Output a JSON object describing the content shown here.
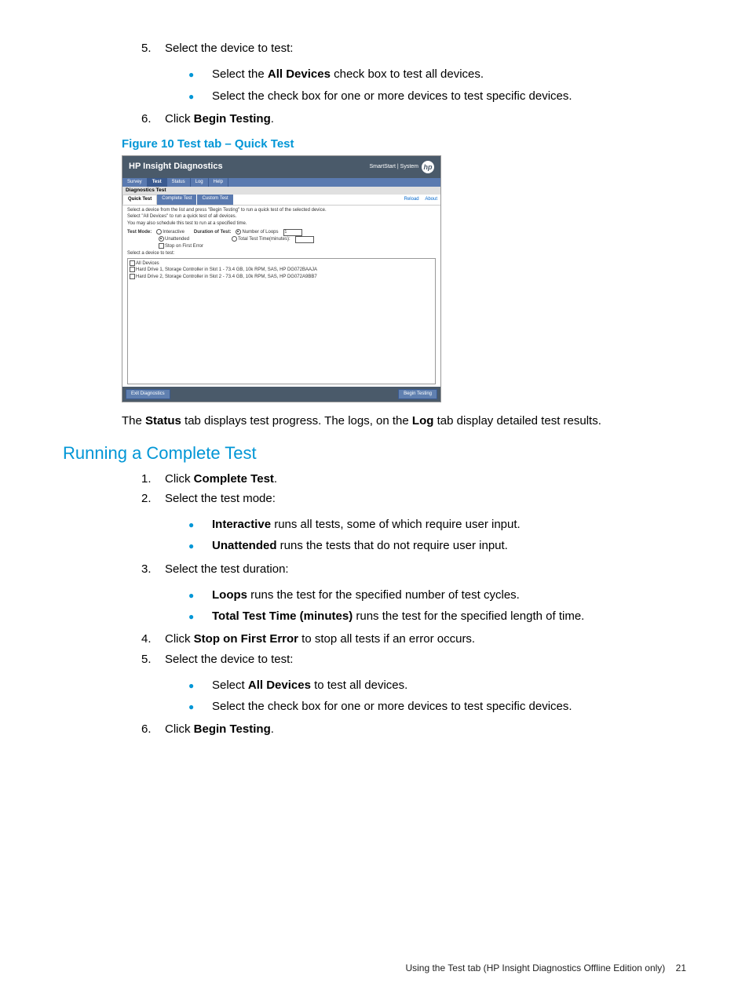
{
  "steps_top": {
    "s5": {
      "num": "5.",
      "text": "Select the device to test:",
      "bullets": [
        {
          "pre": "Select the ",
          "bold": "All Devices",
          "post": " check box to test all devices."
        },
        {
          "pre": "Select the check box for one or more devices to test specific devices.",
          "bold": "",
          "post": ""
        }
      ]
    },
    "s6": {
      "num": "6.",
      "pre": "Click ",
      "bold": "Begin Testing",
      "post": "."
    }
  },
  "figure_caption": "Figure 10 Test tab – Quick Test",
  "screenshot": {
    "title": "HP Insight Diagnostics",
    "header_right": "SmartStart | System",
    "logo": "hp",
    "tabs": [
      "Survey",
      "Test",
      "Status",
      "Log",
      "Help"
    ],
    "active_tab": "Test",
    "section_label": "Diagnostics Test",
    "subtabs": [
      "Quick Test",
      "Complete Test",
      "Custom Test"
    ],
    "active_subtab": "Quick Test",
    "links": [
      "Reload",
      "About"
    ],
    "instr1": "Select a device from the list and press \"Begin Testing\" to run a quick test of the selected device.",
    "instr2": "Select \"All Devices\" to run a quick test of all devices.",
    "instr3": "You may also schedule this test to run at a specified time.",
    "test_mode_label": "Test Mode:",
    "interactive": "Interactive",
    "unattended": "Unattended",
    "duration_label": "Duration of Test:",
    "loops_label": "Number of Loops",
    "loops_value": "1",
    "time_label": "Total Test Time(minutes):",
    "time_value": "",
    "stop_label": "Stop on First Error",
    "select_device": "Select a device to test:",
    "devices": [
      "All Devices",
      "Hard Drive 1, Storage Controller in Slot 1 - 73.4 GB, 10k RPM, SAS, HP DG072BAAJA",
      "Hard Drive 2, Storage Controller in Slot 2 - 73.4 GB, 10k RPM, SAS, HP DG072A9BB7"
    ],
    "btn_exit": "Exit Diagnostics",
    "btn_begin": "Begin Testing"
  },
  "paragraph": {
    "p1": "The ",
    "b1": "Status",
    "p2": " tab displays test progress. The logs, on the ",
    "b2": "Log",
    "p3": " tab display detailed test results."
  },
  "section_heading": "Running a Complete Test",
  "steps_bottom": {
    "s1": {
      "num": "1.",
      "pre": "Click ",
      "bold": "Complete Test",
      "post": "."
    },
    "s2": {
      "num": "2.",
      "text": "Select the test mode:",
      "bullets": [
        {
          "bold": "Interactive",
          "post": " runs all tests, some of which require user input."
        },
        {
          "bold": "Unattended",
          "post": " runs the tests that do not require user input."
        }
      ]
    },
    "s3": {
      "num": "3.",
      "text": "Select the test duration:",
      "bullets": [
        {
          "bold": "Loops",
          "post": " runs the test for the specified number of test cycles."
        },
        {
          "bold": "Total Test Time (minutes)",
          "post": " runs the test for the specified length of time."
        }
      ]
    },
    "s4": {
      "num": "4.",
      "pre": "Click ",
      "bold": "Stop on First Error",
      "post": " to stop all tests if an error occurs."
    },
    "s5": {
      "num": "5.",
      "text": "Select the device to test:",
      "bullets": [
        {
          "pre": "Select ",
          "bold": "All Devices",
          "post": " to test all devices."
        },
        {
          "pre": "Select the check box for one or more devices to test specific devices.",
          "bold": "",
          "post": ""
        }
      ]
    },
    "s6": {
      "num": "6.",
      "pre": "Click ",
      "bold": "Begin Testing",
      "post": "."
    }
  },
  "footer": {
    "text": "Using the Test tab (HP Insight Diagnostics Offline Edition only)",
    "page": "21"
  }
}
